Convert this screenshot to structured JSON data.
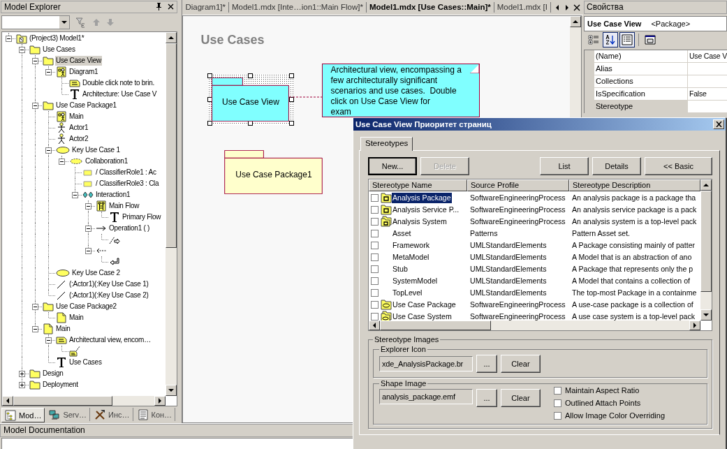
{
  "explorer": {
    "title": "Model Explorer",
    "tree": [
      {
        "label": "(Project3) Model1*",
        "kind": "model",
        "expanded": true,
        "selected": false,
        "children": [
          {
            "label": "Use Cases",
            "kind": "folder",
            "expanded": true,
            "selected": false,
            "children": [
              {
                "label": "Use Case View",
                "kind": "folder",
                "expanded": true,
                "selected": true,
                "children": [
                  {
                    "label": "Diagram1",
                    "kind": "diagram",
                    "expanded": true,
                    "selected": false,
                    "children": [
                      {
                        "label": "Double click note to brin.",
                        "kind": "note",
                        "selected": false
                      },
                      {
                        "label": "Architecture: Use Case V",
                        "kind": "text",
                        "selected": false
                      }
                    ]
                  }
                ]
              },
              {
                "label": "Use Case Package1",
                "kind": "folder",
                "expanded": true,
                "selected": false,
                "children": [
                  {
                    "label": "Main",
                    "kind": "diagram",
                    "selected": false
                  },
                  {
                    "label": "Actor1",
                    "kind": "actor",
                    "selected": false
                  },
                  {
                    "label": "Actor2",
                    "kind": "actor",
                    "selected": false
                  },
                  {
                    "label": "Key Use Case 1",
                    "kind": "usecase",
                    "expanded": true,
                    "selected": false,
                    "children": [
                      {
                        "label": "Collaboration1",
                        "kind": "collaboration",
                        "expanded": true,
                        "selected": false,
                        "children": [
                          {
                            "label": "/ ClassifierRole1 : Ac",
                            "kind": "role",
                            "selected": false
                          },
                          {
                            "label": "/ ClassifierRole3 : Cla",
                            "kind": "role",
                            "selected": false
                          },
                          {
                            "label": "Interaction1",
                            "kind": "interaction",
                            "expanded": true,
                            "selected": false,
                            "children": [
                              {
                                "label": "Main Flow",
                                "kind": "sequence",
                                "expanded": true,
                                "selected": false,
                                "children": [
                                  {
                                    "label": "Primary Flow",
                                    "kind": "text",
                                    "selected": false
                                  }
                                ]
                              },
                              {
                                "label": "Operation1 ( )",
                                "kind": "message",
                                "expanded": true,
                                "selected": false,
                                "children": [
                                  {
                                    "kind": "send",
                                    "selected": false
                                  }
                                ]
                              },
                              {
                                "kind": "reply",
                                "expanded": true,
                                "selected": false,
                                "children": [
                                  {
                                    "kind": "return",
                                    "selected": false
                                  }
                                ]
                              }
                            ]
                          }
                        ]
                      }
                    ]
                  },
                  {
                    "label": "Key Use Case 2",
                    "kind": "usecase",
                    "selected": false
                  },
                  {
                    "label": "(:Actor1)(:Key Use Case 1)",
                    "kind": "association",
                    "selected": false
                  },
                  {
                    "label": "(:Actor1)(:Key Use Case 2)",
                    "kind": "association",
                    "selected": false
                  }
                ]
              },
              {
                "label": "Use Case Package2",
                "kind": "folder",
                "expanded": true,
                "selected": false,
                "children": [
                  {
                    "label": "Main",
                    "kind": "document",
                    "selected": false
                  }
                ]
              },
              {
                "label": "Main",
                "kind": "document",
                "expanded": true,
                "selected": false,
                "children": [
                  {
                    "label": "Architectural view, encom…",
                    "kind": "note",
                    "expanded": true,
                    "selected": false,
                    "children": [
                      {
                        "kind": "notelink",
                        "selected": false
                      }
                    ]
                  },
                  {
                    "label": "Use Cases",
                    "kind": "text",
                    "selected": false
                  }
                ]
              }
            ]
          },
          {
            "label": "Design",
            "kind": "folder",
            "expanded": false,
            "selected": false
          },
          {
            "label": "Deployment",
            "kind": "folder",
            "expanded": false,
            "selected": false
          }
        ]
      }
    ],
    "tabs": [
      {
        "label": "Mod…",
        "kind": "model",
        "selected": true
      },
      {
        "label": "Serv…",
        "kind": "server",
        "selected": false
      },
      {
        "label": "Инс…",
        "kind": "tools",
        "selected": false
      },
      {
        "label": "Кон…",
        "kind": "list",
        "selected": false
      }
    ]
  },
  "editor": {
    "tabs": [
      {
        "label": "Diagram1]*",
        "selected": false
      },
      {
        "label": "Model1.mdx [Inte…ion1::Main Flow]*",
        "selected": false
      },
      {
        "label": "Model1.mdx [Use Cases::Main]*",
        "selected": true
      },
      {
        "label": "Model1.mdx [I",
        "selected": false
      }
    ],
    "diagram": {
      "title": "Use Cases",
      "packages": [
        {
          "label": "Use Case View",
          "selected": true,
          "color": "#80ffff"
        },
        {
          "label": "Use Case Package1",
          "selected": false,
          "color": "#ffffcc"
        }
      ],
      "note": {
        "text": "Architectural view, encompassing a few architecturally significant scenarios and use cases.  Double click on Use Case View for\nexam",
        "color": "#80ffff"
      }
    }
  },
  "properties": {
    "title": "Свойства",
    "element_name": "Use Case View",
    "element_type": "<Package>",
    "tools": [
      {
        "kind": "categorized",
        "pressed": false
      },
      {
        "kind": "alphabetical",
        "pressed": true
      },
      {
        "kind": "properties",
        "pressed": true
      },
      {
        "kind": "pages",
        "pressed": false
      }
    ],
    "rows": [
      {
        "name": "(Name)",
        "value": "Use Case V",
        "selected": false
      },
      {
        "name": "Alias",
        "selected": false
      },
      {
        "name": "Collections",
        "selected": false
      },
      {
        "name": "IsSpecification",
        "value": "False",
        "selected": false
      },
      {
        "name": "Stereotype",
        "selected": true
      }
    ]
  },
  "dialog": {
    "title": "Use Case View Приоритет страниц",
    "tabs": [
      {
        "label": "Stereotypes",
        "selected": true
      }
    ],
    "buttons": [
      {
        "label": "New...",
        "disabled": false
      },
      {
        "label": "Delete",
        "disabled": true
      },
      {
        "label": "List",
        "disabled": false
      },
      {
        "label": "Details",
        "disabled": false
      },
      {
        "label": "<< Basic",
        "disabled": false
      }
    ],
    "columns": [
      "Stereotype Name",
      "Source Profile",
      "Stereotype Description"
    ],
    "rows": [
      {
        "name": "Analysis Package",
        "kind": "analysis",
        "profile": "SoftwareEngineeringProcess",
        "description": "An analysis package is a package tha",
        "checked": false,
        "selected": true
      },
      {
        "name": "Analysis Service P...",
        "kind": "analysis",
        "profile": "SoftwareEngineeringProcess",
        "description": "An analysis service package is a pack",
        "checked": false,
        "selected": false
      },
      {
        "name": "Analysis System",
        "kind": "system",
        "profile": "SoftwareEngineeringProcess",
        "description": "An analysis system is a top-level pack",
        "checked": false,
        "selected": false
      },
      {
        "name": "Asset",
        "kind": "plain",
        "profile": "Patterns",
        "description": "Pattern Asset set.",
        "checked": false,
        "selected": false
      },
      {
        "name": "Framework",
        "kind": "plain",
        "profile": "UMLStandardElements",
        "description": "A Package consisting mainly of patter",
        "checked": false,
        "selected": false
      },
      {
        "name": "MetaModel",
        "kind": "plain",
        "profile": "UMLStandardElements",
        "description": "A Model that is an abstraction of ano",
        "checked": false,
        "selected": false
      },
      {
        "name": "Stub",
        "kind": "plain",
        "profile": "UMLStandardElements",
        "description": "A Package that represents only the p",
        "checked": false,
        "selected": false
      },
      {
        "name": "SystemModel",
        "kind": "plain",
        "profile": "UMLStandardElements",
        "description": "A Model that contains a collection of",
        "checked": false,
        "selected": false
      },
      {
        "name": "TopLevel",
        "kind": "plain",
        "profile": "UMLStandardElements",
        "description": "The top-most Package in a containme",
        "checked": false,
        "selected": false
      },
      {
        "name": "Use Case Package",
        "kind": "usecase",
        "profile": "SoftwareEngineeringProcess",
        "description": "A use-case package is a collection of",
        "checked": false,
        "selected": false
      },
      {
        "name": "Use Case System",
        "kind": "usecase-system",
        "profile": "SoftwareEngineeringProcess",
        "description": "A use case system is a top-level pack",
        "checked": false,
        "selected": false
      }
    ],
    "images": {
      "title": "Stereotype Images",
      "explorer_icon": {
        "title": "Explorer Icon",
        "value": "xde_AnalysisPackage.br",
        "browse": "...",
        "clear": "Clear"
      },
      "shape_image": {
        "title": "Shape Image",
        "value": "analysis_package.emf",
        "browse": "...",
        "clear": "Clear",
        "options": [
          {
            "label": "Maintain Aspect Ratio",
            "checked": false
          },
          {
            "label": "Outlined Attach Points",
            "checked": false
          },
          {
            "label": "Allow Image Color Overriding",
            "checked": false
          }
        ]
      }
    }
  },
  "documentation": {
    "title": "Model Documentation"
  }
}
